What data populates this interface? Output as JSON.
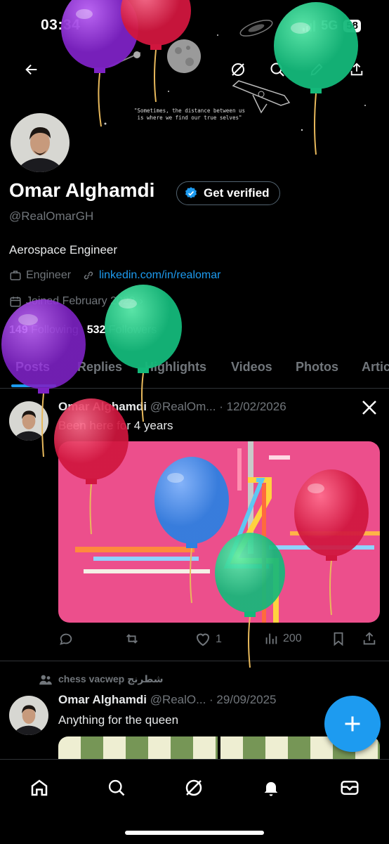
{
  "status_bar": {
    "time": "03:34",
    "network": "5G",
    "battery": "58"
  },
  "banner": {
    "quote": "\"Sometimes, the distance between us is where we find our true selves\""
  },
  "profile": {
    "name": "Omar Alghamdi",
    "verify_label": "Get verified",
    "handle": "@RealOmarGH",
    "bio": "Aerospace Engineer",
    "category": "Engineer",
    "link": "linkedin.com/in/realomar",
    "joined": "Joined February 2022",
    "following_count": "149",
    "following_label": "Following",
    "followers_count": "532",
    "followers_label": "Followers"
  },
  "tabs": [
    "Posts",
    "Replies",
    "Highlights",
    "Videos",
    "Photos",
    "Artic"
  ],
  "posts": [
    {
      "name": "Omar Alghamdi",
      "handle": "@RealOm...",
      "date": "· 12/02/2026",
      "text": "Been here for 4 years",
      "replies": "",
      "reposts": "",
      "likes": "1",
      "views": "200"
    },
    {
      "context": "chess vacwep شطرنج",
      "name": "Omar Alghamdi",
      "handle": "@RealO...",
      "date": "· 29/09/2025",
      "text": "Anything for the queen"
    }
  ],
  "icons": {
    "back": "arrow-left-icon",
    "grok": "grok-icon",
    "search": "search-icon",
    "edit": "pencil-icon",
    "share": "share-icon",
    "x_logo": "x-logo-icon",
    "verified": "verified-badge-icon",
    "compose": "plus-icon"
  },
  "colors": {
    "accent": "#1d9bf0",
    "media_bg": "#ec4f8c",
    "background": "#000000"
  }
}
